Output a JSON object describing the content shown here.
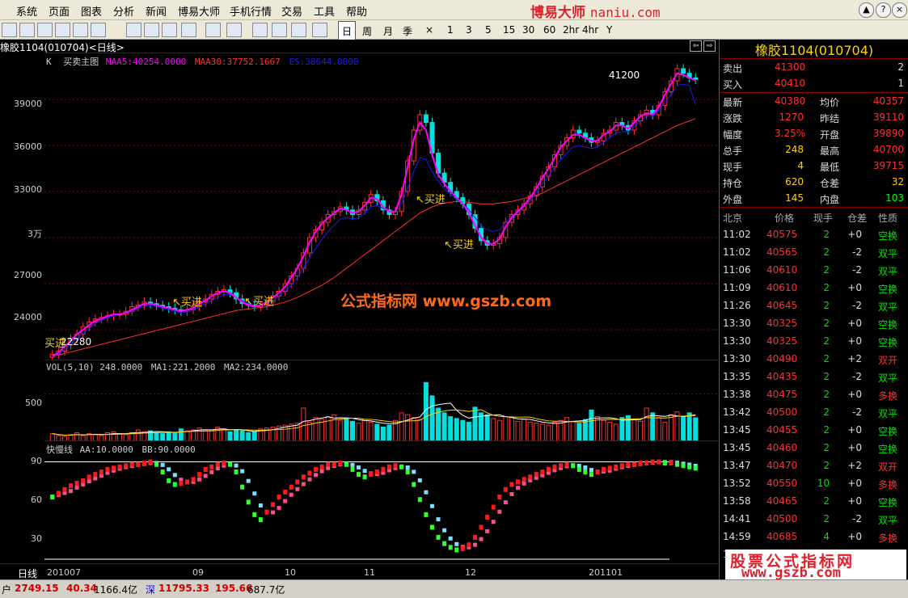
{
  "menu": [
    "系统",
    "页面",
    "图表",
    "分析",
    "新闻",
    "博易大师",
    "手机行情",
    "交易",
    "工具",
    "帮助"
  ],
  "brand": {
    "name": "博易大师",
    "url": "naniu.com"
  },
  "window_buttons": [
    "▲",
    "?",
    "×"
  ],
  "periods": [
    "日",
    "周",
    "月",
    "季",
    "×",
    "1",
    "3",
    "5",
    "15",
    "30",
    "60",
    "2hr",
    "4hr",
    "Y"
  ],
  "active_period": "日",
  "chart": {
    "title": "橡胶1104(010704)<日线>",
    "main_indicator": {
      "k": "K",
      "name": "买卖主图",
      "maa5": "MAA5:40254.0000",
      "maa30": "MAA30:37752.1667",
      "es": "ES:38644.0000"
    },
    "vol_indicator": {
      "name": "VOL(5,10)",
      "value": "248.0000",
      "ma1": "MA1:221.2000",
      "ma2": "MA2:234.0000"
    },
    "osc_indicator": {
      "name": "快慢线",
      "aa": "AA:10.0000",
      "bb": "BB:90.0000"
    },
    "high_label": "41200",
    "low_label": "22280",
    "buy_label": "买进",
    "watermark": "公式指标网  www.gszb.com",
    "period_label": "日线",
    "colors": {
      "up": "#ff3030",
      "down": "#00e0e0",
      "maa5": "#ff00ff",
      "maa30": "#ff3030",
      "es": "#1a1aff",
      "buy": "#ffd000"
    }
  },
  "chart_data": {
    "type": "line",
    "ylim": [
      22000,
      42000
    ],
    "y_ticks": [
      "39000",
      "36000",
      "33000",
      "3万",
      "27000",
      "24000"
    ],
    "x_ticks": [
      "201007",
      "09",
      "10",
      "11",
      "12",
      "201101"
    ],
    "vol_ticks": [
      "500"
    ],
    "osc_ticks": [
      "90",
      "60",
      "30"
    ],
    "price_series": [
      22400,
      22600,
      23000,
      23400,
      23700,
      24200,
      24500,
      24700,
      24800,
      24900,
      25000,
      25000,
      25200,
      25500,
      25600,
      25800,
      25700,
      25600,
      25500,
      25400,
      25300,
      25200,
      25300,
      25500,
      25800,
      26000,
      26300,
      26500,
      26600,
      26400,
      26000,
      25700,
      25600,
      25500,
      25600,
      25800,
      26200,
      26500,
      27000,
      27500,
      28000,
      29000,
      30000,
      30500,
      31000,
      31500,
      31700,
      32000,
      31800,
      31500,
      31800,
      32300,
      32800,
      32400,
      31800,
      31500,
      31700,
      33000,
      35000,
      37000,
      38000,
      37500,
      35500,
      34200,
      33600,
      33000,
      32600,
      32200,
      31500,
      30600,
      29800,
      29500,
      29600,
      30000,
      31000,
      31500,
      31800,
      32200,
      32700,
      33300,
      34000,
      34600,
      35400,
      36000,
      36500,
      37000,
      36800,
      36500,
      36200,
      36300,
      36800,
      37000,
      37500,
      37300,
      37000,
      37600,
      38000,
      38300,
      38000,
      38600,
      39500,
      40200,
      41000,
      40700,
      40400,
      40300
    ],
    "maa5_series": [
      22280,
      22500,
      22900,
      23300,
      23700,
      24000,
      24300,
      24600,
      24700,
      24900,
      25000,
      25000,
      25100,
      25300,
      25500,
      25700,
      25700,
      25600,
      25500,
      25400,
      25300,
      25200,
      25300,
      25400,
      25700,
      25900,
      26200,
      26400,
      26500,
      26400,
      26100,
      25800,
      25600,
      25500,
      25600,
      25800,
      26100,
      26400,
      26800,
      27400,
      28000,
      28800,
      29700,
      30400,
      30900,
      31300,
      31600,
      31900,
      31800,
      31600,
      31700,
      32100,
      32600,
      32500,
      32000,
      31700,
      31700,
      32800,
      34600,
      36400,
      37500,
      37000,
      35400,
      34100,
      33500,
      33000,
      32600,
      32200,
      31600,
      30800,
      30000,
      29600,
      29600,
      29900,
      30700,
      31300,
      31700,
      32100,
      32600,
      33200,
      33900,
      34500,
      35200,
      35900,
      36300,
      36700,
      36700,
      36500,
      36300,
      36300,
      36700,
      36900,
      37300,
      37300,
      37100,
      37500,
      37900,
      38100,
      38000,
      38500,
      39300,
      40000,
      40700,
      40600,
      40400,
      40254
    ],
    "es_series": [
      22280,
      22400,
      22700,
      23100,
      23400,
      23800,
      24100,
      24400,
      24600,
      24800,
      24900,
      25000,
      25100,
      25200,
      25400,
      25500,
      25600,
      25500,
      25400,
      25300,
      25200,
      25100,
      25150,
      25300,
      25500,
      25700,
      25900,
      26100,
      26300,
      26300,
      26100,
      25900,
      25700,
      25600,
      25600,
      25700,
      25900,
      26200,
      26500,
      26900,
      27400,
      28000,
      28700,
      29300,
      29900,
      30400,
      30800,
      31200,
      31300,
      31200,
      31300,
      31600,
      32000,
      32100,
      31900,
      31700,
      31700,
      32200,
      33200,
      34300,
      35200,
      35100,
      34300,
      33700,
      33200,
      32800,
      32500,
      32200,
      31800,
      31300,
      30800,
      30500,
      30400,
      30500,
      31000,
      31400,
      31700,
      32000,
      32400,
      32900,
      33500,
      34000,
      34600,
      35100,
      35500,
      35900,
      36000,
      35900,
      35800,
      35900,
      36200,
      36500,
      36800,
      36900,
      36900,
      37200,
      37600,
      37900,
      37900,
      38300,
      38800,
      39300,
      39900,
      40000,
      39900,
      38644
    ],
    "maa30_series": [
      22280,
      22350,
      22450,
      22550,
      22650,
      22750,
      22850,
      22950,
      23050,
      23150,
      23250,
      23350,
      23450,
      23550,
      23650,
      23750,
      23850,
      23950,
      24050,
      24150,
      24250,
      24350,
      24450,
      24550,
      24650,
      24750,
      24850,
      24950,
      25050,
      25150,
      25250,
      25300,
      25350,
      25400,
      25450,
      25500,
      25600,
      25700,
      25800,
      25950,
      26100,
      26300,
      26500,
      26700,
      26900,
      27150,
      27400,
      27700,
      28000,
      28300,
      28600,
      28900,
      29200,
      29500,
      29800,
      30100,
      30400,
      30700,
      31000,
      31300,
      31600,
      31800,
      32000,
      32150,
      32250,
      32300,
      32350,
      32350,
      32300,
      32250,
      32200,
      32200,
      32200,
      32250,
      32300,
      32350,
      32450,
      32550,
      32650,
      32750,
      32900,
      33100,
      33300,
      33500,
      33700,
      33900,
      34100,
      34300,
      34500,
      34700,
      34900,
      35100,
      35300,
      35500,
      35700,
      35900,
      36100,
      36300,
      36500,
      36700,
      36900,
      37100,
      37300,
      37450,
      37600,
      37752
    ],
    "volume_series": [
      80,
      60,
      50,
      70,
      90,
      60,
      80,
      70,
      60,
      90,
      100,
      80,
      70,
      90,
      120,
      100,
      110,
      90,
      80,
      100,
      90,
      130,
      110,
      120,
      140,
      110,
      120,
      150,
      130,
      100,
      120,
      110,
      90,
      100,
      130,
      140,
      150,
      160,
      170,
      180,
      190,
      350,
      200,
      250,
      230,
      260,
      280,
      220,
      240,
      210,
      190,
      230,
      200,
      180,
      150,
      170,
      220,
      300,
      280,
      250,
      230,
      620,
      480,
      350,
      300,
      260,
      240,
      220,
      200,
      360,
      300,
      280,
      240,
      220,
      260,
      250,
      210,
      230,
      200,
      190,
      180,
      170,
      200,
      220,
      250,
      210,
      190,
      230,
      330,
      260,
      220,
      200,
      180,
      250,
      270,
      230,
      210,
      350,
      300,
      250,
      200,
      280,
      310,
      260,
      300,
      248
    ],
    "osc_series": [
      62,
      65,
      68,
      71,
      73,
      75,
      78,
      80,
      82,
      84,
      85,
      86,
      87,
      88,
      88,
      89,
      90,
      88,
      82,
      75,
      72,
      73,
      74,
      76,
      80,
      84,
      86,
      88,
      89,
      88,
      82,
      70,
      58,
      48,
      44,
      50,
      56,
      62,
      66,
      70,
      74,
      78,
      81,
      84,
      86,
      88,
      88,
      89,
      88,
      84,
      80,
      78,
      80,
      82,
      84,
      86,
      87,
      86,
      82,
      72,
      60,
      48,
      38,
      30,
      25,
      22,
      20,
      21,
      24,
      30,
      38,
      46,
      54,
      62,
      68,
      72,
      74,
      76,
      78,
      80,
      82,
      84,
      86,
      87,
      88,
      87,
      84,
      82,
      80,
      82,
      84,
      85,
      86,
      87,
      88,
      88,
      89,
      89,
      90,
      90,
      89,
      89,
      88,
      87,
      86,
      85
    ]
  },
  "quote": {
    "title": "橡胶1104(010704)",
    "sell": {
      "label": "卖出",
      "price": "41300",
      "vol": "2"
    },
    "buy": {
      "label": "买入",
      "price": "40410",
      "vol": "1"
    },
    "rows": [
      {
        "l1": "最新",
        "v1": "40380",
        "l2": "均价",
        "v2": "40357"
      },
      {
        "l1": "涨跌",
        "v1": "1270",
        "l2": "昨结",
        "v2": "39110"
      },
      {
        "l1": "幅度",
        "v1": "3.25%",
        "l2": "开盘",
        "v2": "39890"
      },
      {
        "l1": "总手",
        "v1": "248",
        "l2": "最高",
        "v2": "40700"
      },
      {
        "l1": "现手",
        "v1": "4",
        "l2": "最低",
        "v2": "39715"
      },
      {
        "l1": "持仓",
        "v1": "620",
        "l2": "仓差",
        "v2": "32"
      },
      {
        "l1": "外盘",
        "v1": "145",
        "l2": "内盘",
        "v2": "103"
      }
    ],
    "trade_header": [
      "北京",
      "价格",
      "现手",
      "仓差",
      "性质"
    ],
    "trades": [
      {
        "t": "11:02",
        "p": "40575",
        "v": "2",
        "d": "+0",
        "n": "空换"
      },
      {
        "t": "11:02",
        "p": "40565",
        "v": "2",
        "d": "-2",
        "n": "双平"
      },
      {
        "t": "11:06",
        "p": "40610",
        "v": "2",
        "d": "-2",
        "n": "双平"
      },
      {
        "t": "11:09",
        "p": "40610",
        "v": "2",
        "d": "+0",
        "n": "空换"
      },
      {
        "t": "11:26",
        "p": "40645",
        "v": "2",
        "d": "-2",
        "n": "双平"
      },
      {
        "t": "13:30",
        "p": "40325",
        "v": "2",
        "d": "+0",
        "n": "空换"
      },
      {
        "t": "13:30",
        "p": "40325",
        "v": "2",
        "d": "+0",
        "n": "空换"
      },
      {
        "t": "13:30",
        "p": "40490",
        "v": "2",
        "d": "+2",
        "n": "双开"
      },
      {
        "t": "13:35",
        "p": "40435",
        "v": "2",
        "d": "-2",
        "n": "双平"
      },
      {
        "t": "13:38",
        "p": "40475",
        "v": "2",
        "d": "+0",
        "n": "多换"
      },
      {
        "t": "13:42",
        "p": "40500",
        "v": "2",
        "d": "-2",
        "n": "双平"
      },
      {
        "t": "13:45",
        "p": "40455",
        "v": "2",
        "d": "+0",
        "n": "空换"
      },
      {
        "t": "13:45",
        "p": "40460",
        "v": "2",
        "d": "+0",
        "n": "空换"
      },
      {
        "t": "13:47",
        "p": "40470",
        "v": "2",
        "d": "+2",
        "n": "双开"
      },
      {
        "t": "13:52",
        "p": "40550",
        "v": "10",
        "d": "+0",
        "n": "多换"
      },
      {
        "t": "13:58",
        "p": "40465",
        "v": "2",
        "d": "+0",
        "n": "空换"
      },
      {
        "t": "14:41",
        "p": "40500",
        "v": "2",
        "d": "-2",
        "n": "双平"
      },
      {
        "t": "14:59",
        "p": "40685",
        "v": "4",
        "d": "+0",
        "n": "多换"
      }
    ],
    "trailing": "1"
  },
  "status": {
    "sh_label": "户",
    "sh_index": "2749.15",
    "sh_change": "40.34",
    "sh_amount": "1166.4亿",
    "sz_label": "深",
    "sz_index": "11795.33",
    "sz_change": "195.66",
    "sz_amount": "687.7亿"
  },
  "watermark2": {
    "line1": "股票公式指标网",
    "line2": "www.gszb.com"
  }
}
